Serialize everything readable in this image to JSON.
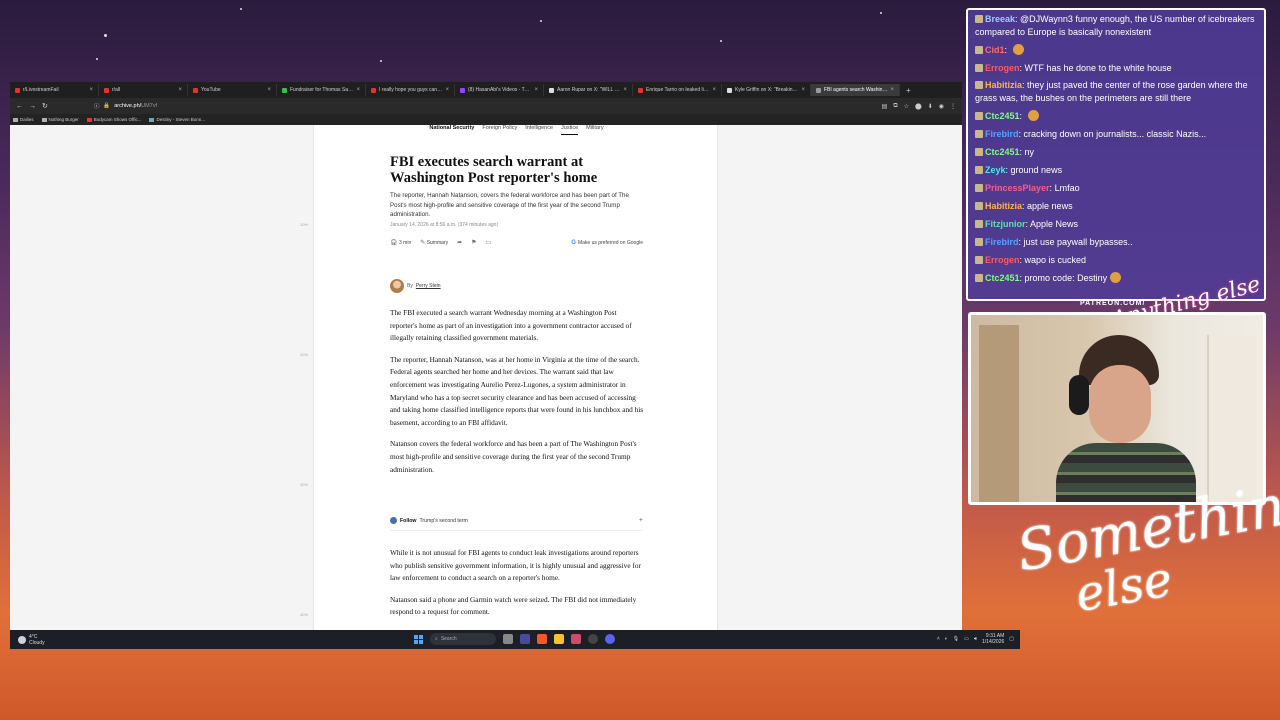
{
  "browser": {
    "tabs": [
      {
        "label": "r/LivestreamFail",
        "active": false
      },
      {
        "label": "r/all",
        "active": false
      },
      {
        "label": "YouTube",
        "active": false
      },
      {
        "label": "Fundraiser for Thomas Sabula i",
        "active": false
      },
      {
        "label": "I really hope you guys can see",
        "active": false
      },
      {
        "label": "(8) HasanAbi's Videos - Twitch",
        "active": false
      },
      {
        "label": "Aaron Rupar on X: \"WILL CAN",
        "active": false
      },
      {
        "label": "Enrique Tarrio on leaked list of",
        "active": false
      },
      {
        "label": "Kyle Griffin on X: \"Breaking Wa",
        "active": false
      },
      {
        "label": "FBI agents search Washington",
        "active": true
      }
    ],
    "url_host": "archive.ph/",
    "url_path": "UM7vf",
    "bookmarks": [
      "Dailies",
      "Nothing Burger",
      "Bodycam Shows Offic...",
      "Destiny - Steven Bonn..."
    ],
    "gutter_marks": [
      "10%",
      "20%",
      "30%",
      "40%"
    ]
  },
  "article": {
    "section_nav": [
      "National Security",
      "Foreign Policy",
      "Intelligence",
      "Justice",
      "Military"
    ],
    "headline": "FBI executes search warrant at Washington Post reporter's home",
    "dek": "The reporter, Hannah Natanson, covers the federal workforce and has been part of The Post's most high-profile and sensitive coverage of the first year of the second Trump administration.",
    "dateline": "January 14, 2026 at 8:56 a.m. (374 minutes ago)",
    "read_time": "3 min",
    "summary_label": "Summary",
    "google_pref": "Make us preferred on Google",
    "byline_prefix": "By",
    "author": "Perry Stein",
    "paragraphs": [
      "The FBI executed a search warrant Wednesday morning at a Washington Post reporter's home as part of an investigation into a government contractor accused of illegally retaining classified government materials.",
      "The reporter, Hannah Natanson, was at her home in Virginia at the time of the search. Federal agents searched her home and her devices. The warrant said that law enforcement was investigating Aurelio Perez-Lugones, a system administrator in Maryland who has a top secret security clearance and has been accused of accessing and taking home classified intelligence reports that were found in his lunchbox and his basement, according to an FBI affidavit.",
      "Natanson covers the federal workforce and has been a part of The Washington Post's most high-profile and sensitive coverage during the first year of the second Trump administration."
    ],
    "follow_label": "Follow",
    "follow_topic": "Trump's second term",
    "paragraphs2": [
      "While it is not unusual for FBI agents to conduct leak investigations around reporters who publish sensitive government information, it is highly unusual and aggressive for law enforcement to conduct a search on a reporter's home.",
      "Natanson said a phone and Garmin watch were seized. The FBI did not immediately respond to a request for comment."
    ]
  },
  "taskbar": {
    "temp": "4°C",
    "weather": "Cloudy",
    "search_label": "Search",
    "time": "9:31 AM",
    "date": "1/14/2026"
  },
  "chat": {
    "messages": [
      {
        "user": "Breeak",
        "color": "#9ecbff",
        "text": "@DJWaynn3 funny enough, the US number of icebreakers compared to Europe is basically nonexistent",
        "wrap": true
      },
      {
        "user": "Cid1",
        "color": "#ff6b6b",
        "text": "",
        "emote": true
      },
      {
        "user": "Errogen",
        "color": "#ff5a5a",
        "text": "WTF has he done to the white house"
      },
      {
        "user": "Habitizia",
        "color": "#ffb347",
        "text": "they just paved the center of the rose garden where the grass was, the bushes on the perimeters are still there",
        "wrap": true
      },
      {
        "user": "Ctc2451",
        "color": "#7dff7d",
        "text": "",
        "emote": true
      },
      {
        "user": "Firebird",
        "color": "#5aa0ff",
        "text": "cracking down on journalists... classic Nazis..."
      },
      {
        "user": "Ctc2451",
        "color": "#7dff7d",
        "text": "ny"
      },
      {
        "user": "Zeyk",
        "color": "#46e8e8",
        "text": "ground news"
      },
      {
        "user": "PrincessPlayer",
        "color": "#ff5a8a",
        "text": "Lmfao"
      },
      {
        "user": "Habitizia",
        "color": "#ffb347",
        "text": "apple news"
      },
      {
        "user": "Fitzjunior",
        "color": "#5ae0b0",
        "text": "Apple News"
      },
      {
        "user": "Firebird",
        "color": "#5aa0ff",
        "text": "just use paywall bypasses.."
      },
      {
        "user": "Errogen",
        "color": "#ff5a5a",
        "text": "wapo is cucked"
      },
      {
        "user": "Ctc2451",
        "color": "#7dff7d",
        "text": "promo code: Destiny",
        "emote": true
      }
    ]
  },
  "overlay": {
    "patreon": "PATREON.COM/",
    "brand_top": "Anything else",
    "brand_big_1": "Something",
    "brand_big_2": "else"
  }
}
